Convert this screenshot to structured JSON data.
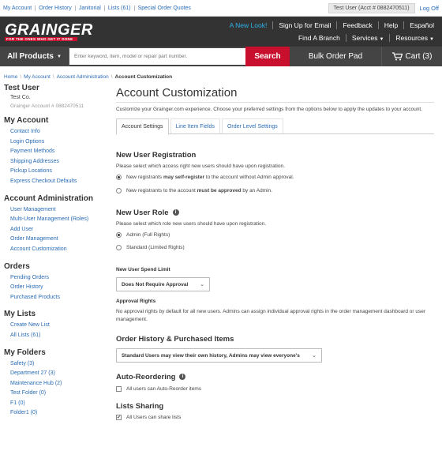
{
  "top_links": [
    "My Account",
    "Order History",
    "Janitorial",
    "Lists (61)",
    "Special Order Quotes"
  ],
  "user_pill": "Test User (Acct # 0882470511)",
  "log_off": "Log Off",
  "brand": {
    "logo": "GRAINGER",
    "tagline": "FOR THE ONES WHO GET IT DONE",
    "accent": "#c8102e",
    "dark": "#333333",
    "link": "#2a6cb5"
  },
  "header_nav": {
    "row1": [
      "A New Look!",
      "Sign Up for Email",
      "Feedback",
      "Help",
      "Español"
    ],
    "row2": [
      "Find A Branch",
      "Services",
      "Resources"
    ]
  },
  "searchbar": {
    "all_products": "All Products",
    "placeholder": "Enter keyword, item, model or repair part number.",
    "search_button": "Search",
    "bulk_order": "Bulk Order Pad",
    "cart": "Cart (3)"
  },
  "breadcrumb": [
    "Home",
    "My Account",
    "Account Administration",
    "Account Customization"
  ],
  "sidebar": {
    "user_name": "Test User",
    "company": "Test Co.",
    "account": "Grainger Account # 0882470511",
    "sections": [
      {
        "heading": "My Account",
        "items": [
          "Contact Info",
          "Login Options",
          "Payment Methods",
          "Shipping Addresses",
          "Pickup Locations",
          "Express Checkout Defaults"
        ]
      },
      {
        "heading": "Account Administration",
        "items": [
          "User Management",
          "Multi-User Management (Roles)",
          "Add User",
          "Order Management",
          "Account Customization"
        ]
      },
      {
        "heading": "Orders",
        "items": [
          "Pending Orders",
          "Order History",
          "Purchased Products"
        ]
      },
      {
        "heading": "My Lists",
        "items": [
          "Create New List",
          "All Lists (61)"
        ]
      },
      {
        "heading": "My Folders",
        "items": [
          "Safety (3)",
          "Department 27 (3)",
          "Maintenance Hub (2)",
          "Test Folder (0)",
          "F1 (0)",
          "Folder1 (0)"
        ]
      }
    ]
  },
  "main": {
    "title": "Account Customization",
    "intro": "Customize your Grainger.com experience. Choose your preferred settings from the options below to apply the updates to your account.",
    "tabs": [
      "Account Settings",
      "Line Item Fields",
      "Order Level Settings"
    ],
    "registration": {
      "heading": "New User Registration",
      "sub": "Please select which access right new users should have upon registration.",
      "opt1_a": "New registrants ",
      "opt1_b": "may self-register",
      "opt1_c": " to the account without Admin approval.",
      "opt2_a": "New registrants to the account ",
      "opt2_b": "must be approved",
      "opt2_c": " by an Admin."
    },
    "role": {
      "heading": "New User Role",
      "sub": "Please select which role new users should have upon registration.",
      "opt1": "Admin (Full Rights)",
      "opt2": "Standard (Limited Rights)"
    },
    "spend": {
      "heading": "New User Spend Limit",
      "selected": "Does Not Require Approval"
    },
    "approval": {
      "heading": "Approval Rights",
      "text": "No approval rights by default for all new users. Admins can assign individual approval rights in the order management dashboard or user management."
    },
    "history": {
      "heading": "Order History & Purchased Items",
      "selected": "Standard Users may view their own history, Admins may view everyone's"
    },
    "reorder": {
      "heading": "Auto-Reordering",
      "option": "All users can Auto-Reorder items"
    },
    "sharing": {
      "heading": "Lists Sharing",
      "option": "All Users can share lists"
    }
  }
}
